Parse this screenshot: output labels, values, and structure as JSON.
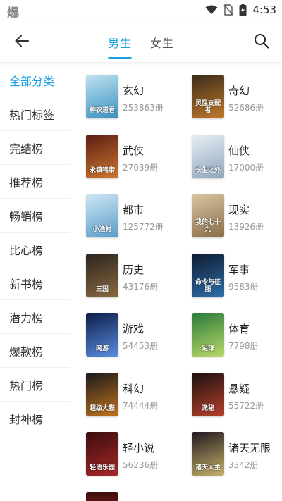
{
  "status_bar": {
    "app_glyph": "爆",
    "time": "4:53",
    "icons": [
      "wifi-icon",
      "no-sim-icon",
      "battery-charging-icon"
    ]
  },
  "header": {
    "back_icon": "arrow-left-icon",
    "search_icon": "search-icon",
    "tabs": [
      {
        "label": "男生",
        "active": true
      },
      {
        "label": "女生",
        "active": false
      }
    ]
  },
  "sidebar": {
    "items": [
      {
        "label": "全部分类",
        "active": true
      },
      {
        "label": "热门标签"
      },
      {
        "label": "完结榜"
      },
      {
        "label": "推荐榜"
      },
      {
        "label": "畅销榜"
      },
      {
        "label": "比心榜"
      },
      {
        "label": "新书榜"
      },
      {
        "label": "潜力榜"
      },
      {
        "label": "爆款榜"
      },
      {
        "label": "热门榜"
      },
      {
        "label": "封神榜"
      }
    ]
  },
  "categories": [
    {
      "name": "玄幻",
      "count": "253863册",
      "cover_text": "神农道君",
      "cover_colors": [
        "#bfe3f0",
        "#3a8fbf"
      ]
    },
    {
      "name": "奇幻",
      "count": "52686册",
      "cover_text": "灵性支配者",
      "cover_colors": [
        "#3a2a1a",
        "#c07a2a"
      ]
    },
    {
      "name": "武侠",
      "count": "27039册",
      "cover_text": "永镇鸣帝",
      "cover_colors": [
        "#5a1e14",
        "#d0772f"
      ]
    },
    {
      "name": "仙侠",
      "count": "17000册",
      "cover_text": "长生之外",
      "cover_colors": [
        "#e8eef4",
        "#8fa7bd"
      ]
    },
    {
      "name": "都市",
      "count": "125772册",
      "cover_text": "小渔村",
      "cover_colors": [
        "#cfe7f4",
        "#5a9cc8"
      ]
    },
    {
      "name": "现实",
      "count": "13926册",
      "cover_text": "我的七十九",
      "cover_colors": [
        "#d9c6a4",
        "#8a6d46"
      ]
    },
    {
      "name": "历史",
      "count": "43176册",
      "cover_text": "三国",
      "cover_colors": [
        "#2b2320",
        "#8a6a3f"
      ]
    },
    {
      "name": "军事",
      "count": "9583册",
      "cover_text": "命令与征服",
      "cover_colors": [
        "#0e1a30",
        "#2f6fa8"
      ]
    },
    {
      "name": "游戏",
      "count": "54453册",
      "cover_text": "网游",
      "cover_colors": [
        "#0c1d48",
        "#5b8de0"
      ]
    },
    {
      "name": "体育",
      "count": "7798册",
      "cover_text": "足球",
      "cover_colors": [
        "#2a7a3a",
        "#b9d96a"
      ]
    },
    {
      "name": "科幻",
      "count": "74444册",
      "cover_text": "超级大猫",
      "cover_colors": [
        "#1a1a1a",
        "#c2731f"
      ]
    },
    {
      "name": "悬疑",
      "count": "55722册",
      "cover_text": "诡秘",
      "cover_colors": [
        "#1a1010",
        "#b8402a"
      ]
    },
    {
      "name": "轻小说",
      "count": "56236册",
      "cover_text": "轻语乐园",
      "cover_colors": [
        "#3a0d0d",
        "#a8282a"
      ]
    },
    {
      "name": "诸天无限",
      "count": "3342册",
      "cover_text": "诸天大主",
      "cover_colors": [
        "#201820",
        "#c5b26a"
      ]
    }
  ],
  "colors": {
    "accent": "#1a9fe0",
    "count_text": "#999999"
  }
}
